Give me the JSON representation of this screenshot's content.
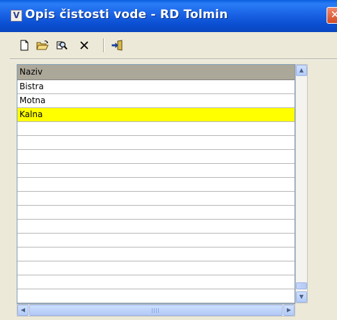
{
  "window": {
    "title": "Opis čistosti vode - RD Tolmin",
    "icon_glyph": "V",
    "close_glyph": "✕"
  },
  "toolbar": {
    "buttons": [
      {
        "name": "new",
        "icon": "new-document-icon"
      },
      {
        "name": "open",
        "icon": "open-folder-icon"
      },
      {
        "name": "search",
        "icon": "magnifier-search-icon"
      },
      {
        "name": "delete",
        "icon": "delete-x-icon"
      },
      {
        "name": "exit",
        "icon": "exit-door-icon"
      }
    ]
  },
  "grid": {
    "columns": [
      "Naziv"
    ],
    "rows": [
      {
        "naziv": "Bistra",
        "selected": false
      },
      {
        "naziv": "Motna",
        "selected": false
      },
      {
        "naziv": "Kalna",
        "selected": true
      }
    ],
    "empty_row_count": 14,
    "selected_color": "#ffff00"
  },
  "scrollbars": {
    "vertical_up": "▲",
    "vertical_down": "▼",
    "horizontal_left": "◀",
    "horizontal_right": "▶"
  },
  "colors": {
    "titlebar": "#0b4fd2",
    "window_bg": "#ece9d8",
    "header_bg": "#aca899",
    "selection": "#ffff00",
    "close_button": "#d34a23"
  }
}
